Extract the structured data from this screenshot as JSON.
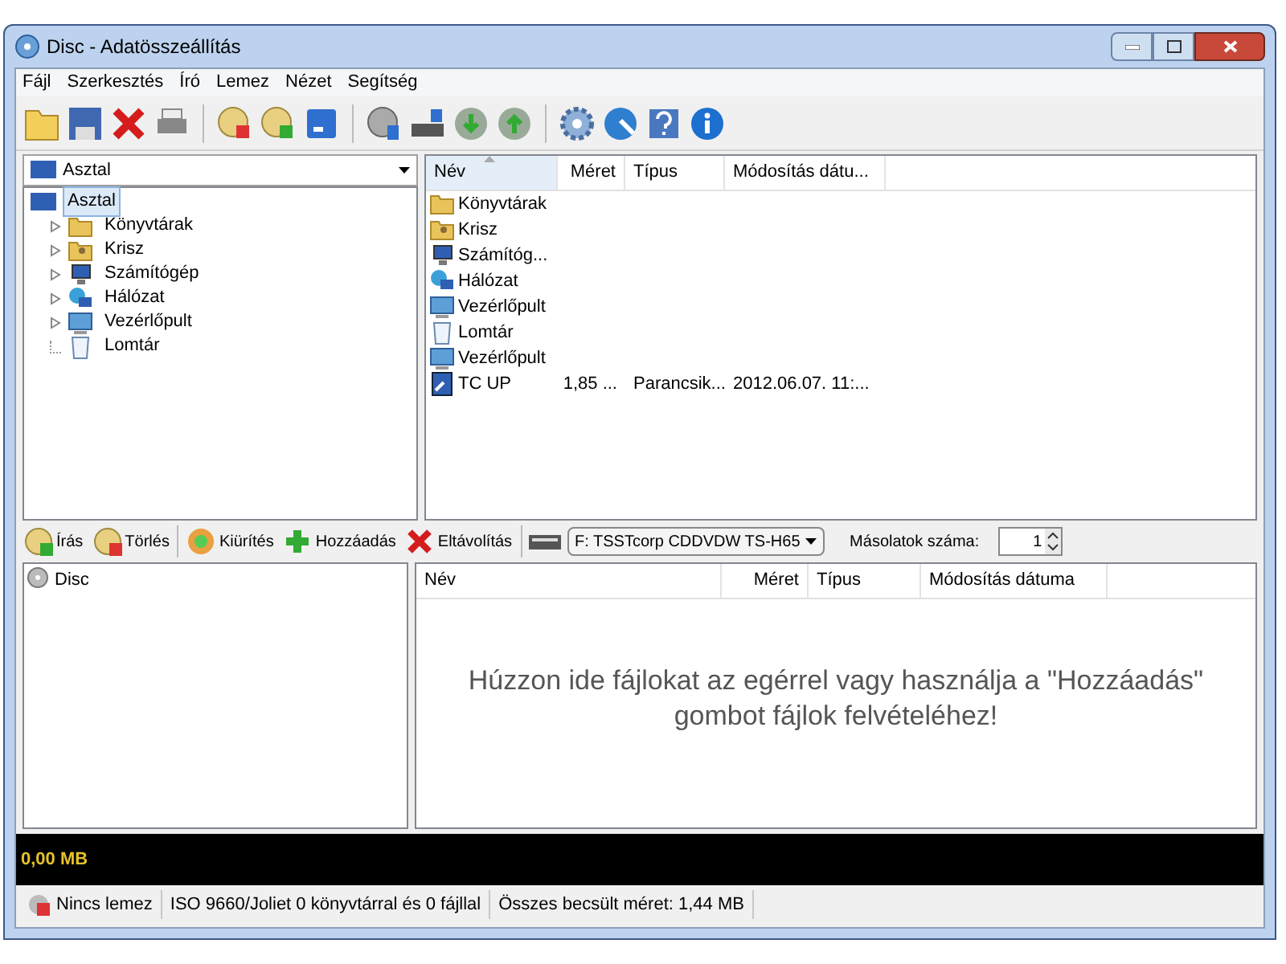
{
  "window": {
    "title": "Disc - Adatösszeállítás"
  },
  "menu": [
    "Fájl",
    "Szerkesztés",
    "Író",
    "Lemez",
    "Nézet",
    "Segítség"
  ],
  "location_combo": {
    "value": "Asztal"
  },
  "tree": [
    {
      "label": "Asztal",
      "selected": true,
      "kind": "root",
      "children": [
        {
          "label": "Könyvtárak",
          "selected": false,
          "kind": "folder"
        },
        {
          "label": "Krisz",
          "selected": false,
          "kind": "folder"
        },
        {
          "label": "Számítógép",
          "selected": false,
          "kind": "folder"
        },
        {
          "label": "Hálózat",
          "selected": false,
          "kind": "folder"
        },
        {
          "label": "Vezérlőpult",
          "selected": false,
          "kind": "folder"
        },
        {
          "label": "Lomtár",
          "selected": false,
          "kind": "leaf"
        }
      ]
    }
  ],
  "file_list": {
    "columns": [
      "Név",
      "Méret",
      "Típus",
      "Módosítás dátu..."
    ],
    "rows": [
      {
        "name": "Könyvtárak",
        "kind": "folder"
      },
      {
        "name": "Krisz",
        "kind": "user"
      },
      {
        "name": "Számítóg...",
        "kind": "computer"
      },
      {
        "name": "Hálózat",
        "kind": "network"
      },
      {
        "name": "Vezérlőpult",
        "kind": "panel"
      },
      {
        "name": "Lomtár",
        "kind": "bin"
      },
      {
        "name": "Vezérlőpult",
        "kind": "panel"
      },
      {
        "name": "TC UP",
        "kind": "shortcut",
        "size": "1,85 ...",
        "type": "Parancsik...",
        "modified": "2012.06.07. 11:..."
      }
    ]
  },
  "burn_toolbar": [
    {
      "kind": "button",
      "label": "Írás"
    },
    {
      "kind": "button",
      "label": "Törlés"
    },
    {
      "kind": "separator"
    },
    {
      "kind": "button",
      "label": "Kiürítés"
    },
    {
      "kind": "button",
      "label": "Hozzáadás"
    },
    {
      "kind": "button",
      "label": "Eltávolítás"
    },
    {
      "kind": "separator"
    },
    {
      "kind": "combo",
      "label": "F: TSSTcorp CDDVDW TS-H65"
    },
    {
      "kind": "spinner",
      "label": "Másolatok száma:",
      "value": "1"
    }
  ],
  "disc_tree": {
    "label": "Disc"
  },
  "disc_list": {
    "columns": [
      "Név",
      "Méret",
      "Típus",
      "Módosítás dátuma"
    ],
    "empty_message": "Húzzon ide fájlokat az egérrel vagy használja a \"Hozzáadás\" gombot fájlok felvételéhez!"
  },
  "capacity_bar": {
    "text": "0,00 MB"
  },
  "status_bar": [
    "Nincs lemez",
    "ISO 9660/Joliet 0 könyvtárral és 0 fájllal",
    "Összes becsült méret: 1,44 MB"
  ]
}
